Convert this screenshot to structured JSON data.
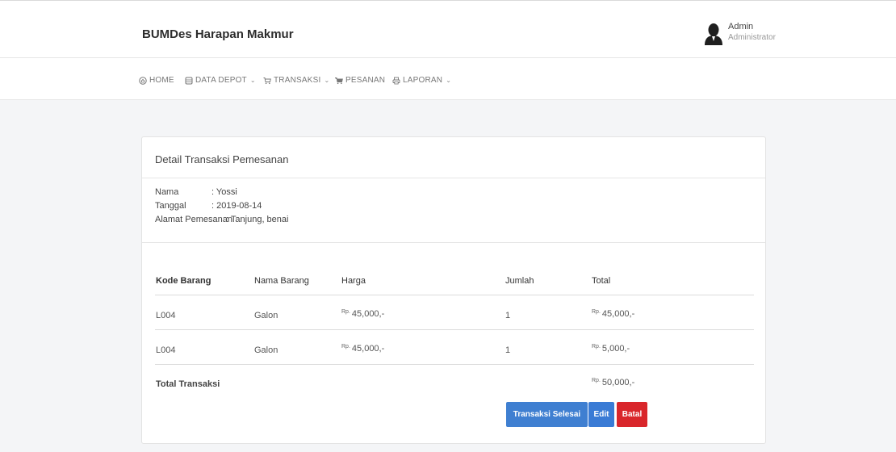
{
  "header": {
    "brand": "BUMDes Harapan Makmur",
    "user": {
      "name": "Admin",
      "role": "Administrator"
    }
  },
  "nav": [
    {
      "label": "HOME",
      "icon": "home-icon",
      "caret": false
    },
    {
      "label": "DATA DEPOT",
      "icon": "database-icon",
      "caret": true
    },
    {
      "label": "TRANSAKSI",
      "icon": "cart-icon",
      "caret": true
    },
    {
      "label": "PESANAN",
      "icon": "cart-full-icon",
      "caret": false
    },
    {
      "label": "LAPORAN",
      "icon": "printer-icon",
      "caret": true
    }
  ],
  "card": {
    "title": "Detail Transaksi Pemesanan",
    "info": {
      "nama_label": "Nama",
      "nama_value": ": Yossi",
      "tanggal_label": "Tanggal",
      "tanggal_value": ": 2019-08-14",
      "alamat_label": "Alamat Pemesanan",
      "alamat_value": ": Tanjung, benai"
    },
    "table": {
      "headers": [
        "Kode Barang",
        "Nama Barang",
        "Harga",
        "Jumlah",
        "Total"
      ],
      "currency": "Rp.",
      "rows": [
        {
          "kode": "L004",
          "nama": "Galon",
          "harga": "45,000,-",
          "jumlah": "1",
          "total": "45,000,-"
        },
        {
          "kode": "L004",
          "nama": "Galon",
          "harga": "45,000,-",
          "jumlah": "1",
          "total": "5,000,-"
        }
      ],
      "total_label": "Total Transaksi",
      "total_value": "50,000,-"
    },
    "buttons": {
      "selesai": "Transaksi Selesai",
      "edit": "Edit",
      "batal": "Batal"
    }
  },
  "colors": {
    "primary": "#3f7fd1",
    "danger": "#d9262b",
    "background": "#f4f5f7"
  }
}
